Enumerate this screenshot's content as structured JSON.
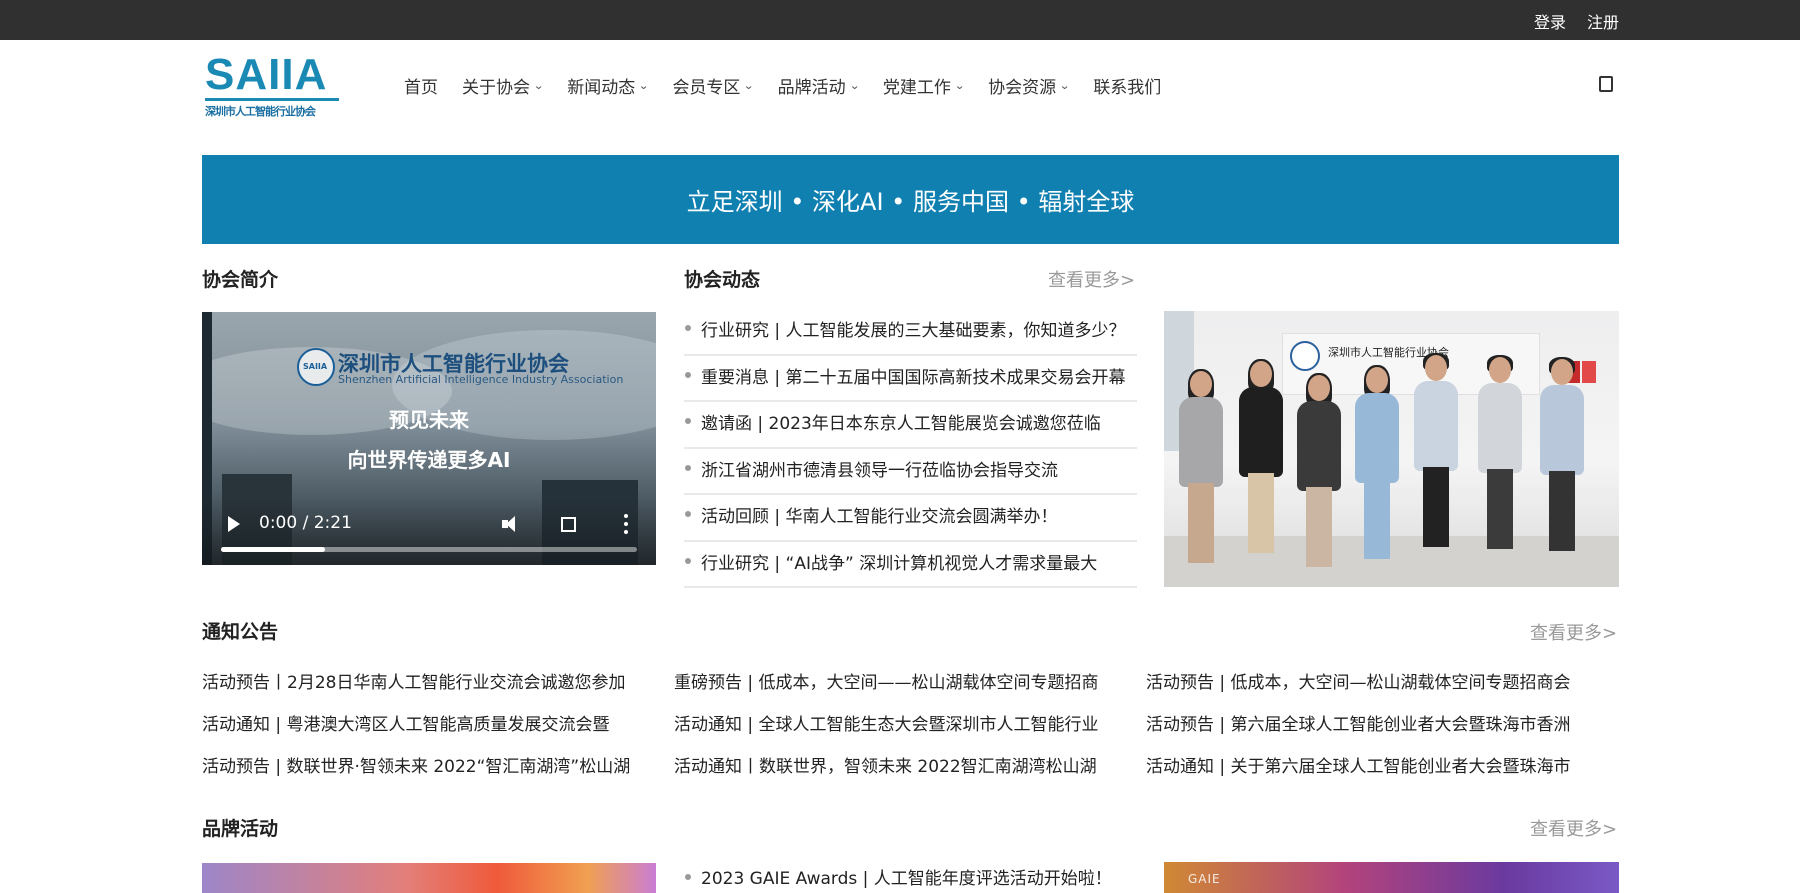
{
  "topbar": {
    "login": "登录",
    "register": "注册"
  },
  "logo": {
    "mark": "SAIIA",
    "subtitle": "深圳市人工智能行业协会"
  },
  "nav": {
    "items": [
      {
        "label": "首页",
        "has_dropdown": false
      },
      {
        "label": "关于协会",
        "has_dropdown": true
      },
      {
        "label": "新闻动态",
        "has_dropdown": true
      },
      {
        "label": "会员专区",
        "has_dropdown": true
      },
      {
        "label": "品牌活动",
        "has_dropdown": true
      },
      {
        "label": "党建工作",
        "has_dropdown": true
      },
      {
        "label": "协会资源",
        "has_dropdown": true
      },
      {
        "label": "联系我们",
        "has_dropdown": false
      }
    ],
    "search_icon": "search-icon"
  },
  "banner": {
    "text": "立足深圳 • 深化AI • 服务中国 • 辐射全球",
    "color": "#1080b1"
  },
  "intro": {
    "title": "协会简介",
    "video": {
      "org_name": "深圳市人工智能行业协会",
      "org_name_en": "Shenzhen Artificial Intelligence Industry Association",
      "line1": "预见未来",
      "line2": "向世界传递更多AI",
      "time": "0:00 / 2:21",
      "progress": 0.25
    }
  },
  "news": {
    "title": "协会动态",
    "more": "查看更多>",
    "items": [
      "行业研究 | 人工智能发展的三大基础要素，你知道多少？",
      "重要消息 | 第二十五届中国国际高新技术成果交易会开幕",
      "邀请函 | 2023年日本东京人工智能展览会诚邀您莅临",
      "浙江省湖州市德清县领导一行莅临协会指导交流",
      "活动回顾 | 华南人工智能行业交流会圆满举办！",
      "行业研究 | “AI战争” 深圳计算机视觉人才需求量最大"
    ]
  },
  "notices": {
    "title": "通知公告",
    "more": "查看更多>",
    "columns": [
      [
        "活动预告丨2月28日华南人工智能行业交流会诚邀您参加",
        "活动通知 | 粤港澳大湾区人工智能高质量发展交流会暨",
        "活动预告 | 数联世界·智领未来 2022“智汇南湖湾”松山湖"
      ],
      [
        "重磅预告 | 低成本，大空间——松山湖载体空间专题招商",
        "活动通知 | 全球人工智能生态大会暨深圳市人工智能行业",
        "活动通知丨数联世界，智领未来 2022智汇南湖湾松山湖"
      ],
      [
        "活动预告 | 低成本，大空间—松山湖载体空间专题招商会",
        "活动预告 | 第六届全球人工智能创业者大会暨珠海市香洲",
        "活动通知 | 关于第六届全球人工智能创业者大会暨珠海市"
      ]
    ]
  },
  "brand": {
    "title": "品牌活动",
    "more": "查看更多>",
    "first_item": "2023 GAIE Awards | 人工智能年度评选活动开始啦！",
    "right_image_label": "GAIE"
  }
}
